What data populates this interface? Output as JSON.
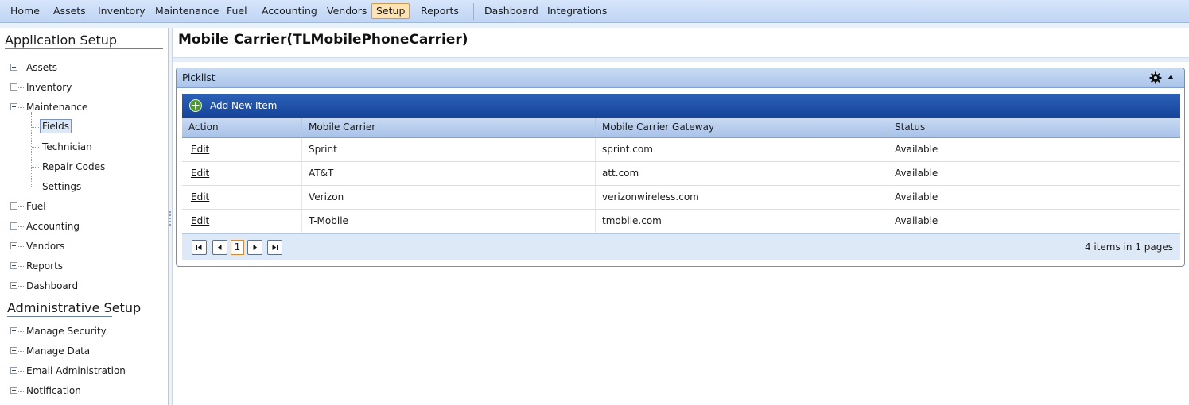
{
  "menu": {
    "items": [
      {
        "label": "Home"
      },
      {
        "label": "Assets"
      },
      {
        "label": "Inventory"
      },
      {
        "label": "Maintenance"
      },
      {
        "label": "Fuel"
      },
      {
        "label": "Accounting"
      },
      {
        "label": "Vendors"
      },
      {
        "label": "Setup",
        "active": true
      },
      {
        "label": "Reports"
      },
      {
        "label": "Dashboard"
      },
      {
        "label": "Integrations"
      }
    ]
  },
  "sidebar": {
    "app_setup_title": "Application Setup",
    "app_items": [
      {
        "label": "Assets"
      },
      {
        "label": "Inventory"
      },
      {
        "label": "Maintenance"
      },
      {
        "label": "Fields"
      },
      {
        "label": "Technician"
      },
      {
        "label": "Repair Codes"
      },
      {
        "label": "Settings"
      },
      {
        "label": "Fuel"
      },
      {
        "label": "Accounting"
      },
      {
        "label": "Vendors"
      },
      {
        "label": "Reports"
      },
      {
        "label": "Dashboard"
      }
    ],
    "admin_setup_title": "Administrative Setup",
    "admin_items": [
      {
        "label": "Manage Security"
      },
      {
        "label": "Manage Data"
      },
      {
        "label": "Email Administration"
      },
      {
        "label": "Notification"
      }
    ]
  },
  "main": {
    "page_title": "Mobile Carrier(TLMobilePhoneCarrier)",
    "picklist": {
      "title": "Picklist",
      "add_label": "Add New Item",
      "columns": [
        "Action",
        "Mobile Carrier",
        "Mobile Carrier Gateway",
        "Status"
      ],
      "rows": [
        {
          "action": "Edit",
          "carrier": "Sprint",
          "gateway": "sprint.com",
          "status": "Available"
        },
        {
          "action": "Edit",
          "carrier": "AT&T",
          "gateway": "att.com",
          "status": "Available"
        },
        {
          "action": "Edit",
          "carrier": "Verizon",
          "gateway": "verizonwireless.com",
          "status": "Available"
        },
        {
          "action": "Edit",
          "carrier": "T-Mobile",
          "gateway": "tmobile.com",
          "status": "Available"
        }
      ],
      "pager": {
        "current_page": "1",
        "info": "4 items in 1 pages"
      }
    }
  },
  "icons": {
    "gear": "gear-icon",
    "collapse": "collapse-arrow-icon",
    "add": "plus-circle-icon",
    "first": "first-page-icon",
    "prev": "prev-page-icon",
    "next": "next-page-icon",
    "last": "last-page-icon"
  },
  "colors": {
    "menu_bg": "#c9dbf6",
    "active_tab": "#fde3b6",
    "toolbar": "#1f56ad",
    "grid_header": "#b7cdee",
    "add_icon": "#4f9a2f"
  }
}
